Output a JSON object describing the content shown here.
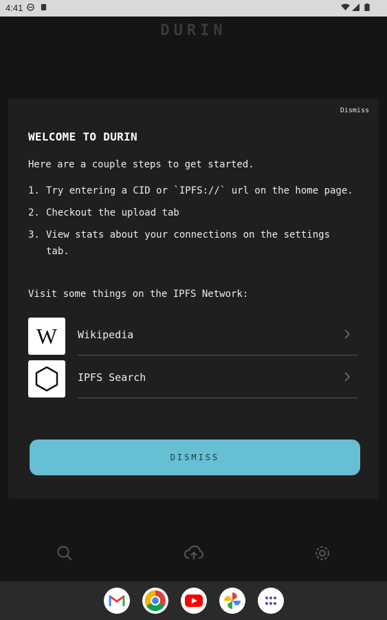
{
  "status_bar": {
    "time": "4:41",
    "icons": [
      "vpn-icon",
      "notification-icon",
      "wifi-icon",
      "signal-icon",
      "battery-icon"
    ]
  },
  "app": {
    "title": "DURIN"
  },
  "dialog": {
    "dismiss_link": "Dismiss",
    "title": "WELCOME TO DURIN",
    "intro": "Here are a couple steps to get started.",
    "steps": [
      {
        "num": "1.",
        "text": "Try entering a CID or `IPFS://` url on the home page."
      },
      {
        "num": "2.",
        "text": "Checkout the upload tab"
      },
      {
        "num": "3.",
        "text": "View stats about your connections on the settings tab."
      }
    ],
    "visit_text": "Visit some things on the IPFS Network:",
    "links": [
      {
        "label": "Wikipedia",
        "icon": "wikipedia-logo"
      },
      {
        "label": "IPFS Search",
        "icon": "hexagon-logo"
      }
    ],
    "dismiss_button": "DISMISS"
  },
  "bottom_nav": {
    "items": [
      "search-icon",
      "upload-cloud-icon",
      "settings-icon"
    ]
  },
  "dock": {
    "apps": [
      "Gmail",
      "Chrome",
      "YouTube",
      "Photos",
      "App drawer"
    ]
  },
  "colors": {
    "accent": "#66bfd2",
    "dialog_bg": "#1f1f1f",
    "background": "#141414"
  }
}
